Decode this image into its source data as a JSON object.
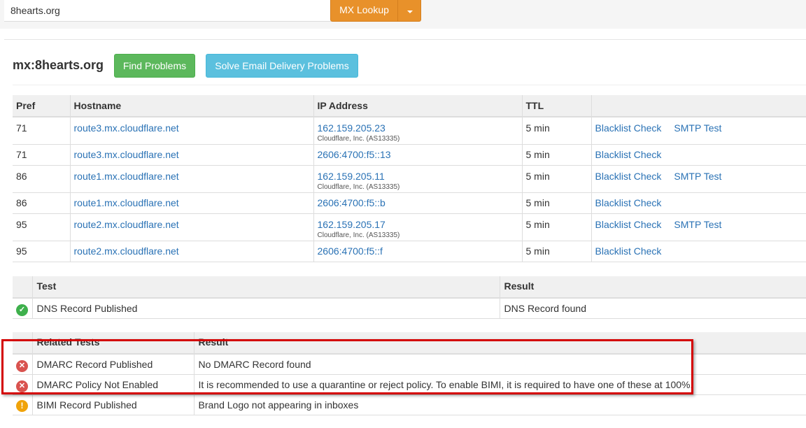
{
  "search": {
    "value": "8hearts.org",
    "button_label": "MX Lookup"
  },
  "page": {
    "title": "mx:8hearts.org",
    "find_problems": "Find Problems",
    "solve_email": "Solve Email Delivery Problems"
  },
  "mx_table": {
    "headers": [
      "Pref",
      "Hostname",
      "IP Address",
      "TTL",
      ""
    ],
    "rows": [
      {
        "pref": "71",
        "hostname": "route3.mx.cloudflare.net",
        "ip": "162.159.205.23",
        "asn": "Cloudflare, Inc. (AS13335)",
        "ttl": "5 min",
        "blacklist": "Blacklist Check",
        "smtp": "SMTP Test"
      },
      {
        "pref": "71",
        "hostname": "route3.mx.cloudflare.net",
        "ip": "2606:4700:f5::13",
        "ttl": "5 min",
        "blacklist": "Blacklist Check"
      },
      {
        "pref": "86",
        "hostname": "route1.mx.cloudflare.net",
        "ip": "162.159.205.11",
        "asn": "Cloudflare, Inc. (AS13335)",
        "ttl": "5 min",
        "blacklist": "Blacklist Check",
        "smtp": "SMTP Test"
      },
      {
        "pref": "86",
        "hostname": "route1.mx.cloudflare.net",
        "ip": "2606:4700:f5::b",
        "ttl": "5 min",
        "blacklist": "Blacklist Check"
      },
      {
        "pref": "95",
        "hostname": "route2.mx.cloudflare.net",
        "ip": "162.159.205.17",
        "asn": "Cloudflare, Inc. (AS13335)",
        "ttl": "5 min",
        "blacklist": "Blacklist Check",
        "smtp": "SMTP Test"
      },
      {
        "pref": "95",
        "hostname": "route2.mx.cloudflare.net",
        "ip": "2606:4700:f5::f",
        "ttl": "5 min",
        "blacklist": "Blacklist Check"
      }
    ]
  },
  "test_table": {
    "headers": [
      "",
      "Test",
      "Result"
    ],
    "rows": [
      {
        "status": "ok",
        "icon": "check-circle-icon",
        "test": "DNS Record Published",
        "result": "DNS Record found"
      }
    ]
  },
  "related_table": {
    "headers": [
      "",
      "Related Tests",
      "Result"
    ],
    "rows": [
      {
        "status": "error",
        "icon": "error-circle-icon",
        "test": "DMARC Record Published",
        "result": "No DMARC Record found"
      },
      {
        "status": "error",
        "icon": "error-circle-icon",
        "test": "DMARC Policy Not Enabled",
        "result": "It is recommended to use a quarantine or reject policy. To enable BIMI, it is required to have one of these at 100%."
      },
      {
        "status": "warning",
        "icon": "warning-circle-icon",
        "test": "BIMI Record Published",
        "result": "Brand Logo not appearing in inboxes"
      }
    ]
  },
  "colors": {
    "lookup_button": "#e8912a",
    "find_button": "#5cb85c",
    "solve_button": "#5bc0de",
    "link": "#2a72b5",
    "ok": "#3eb04c",
    "error": "#d9534f",
    "warning": "#f0a30a",
    "highlight_box": "#d40000"
  }
}
